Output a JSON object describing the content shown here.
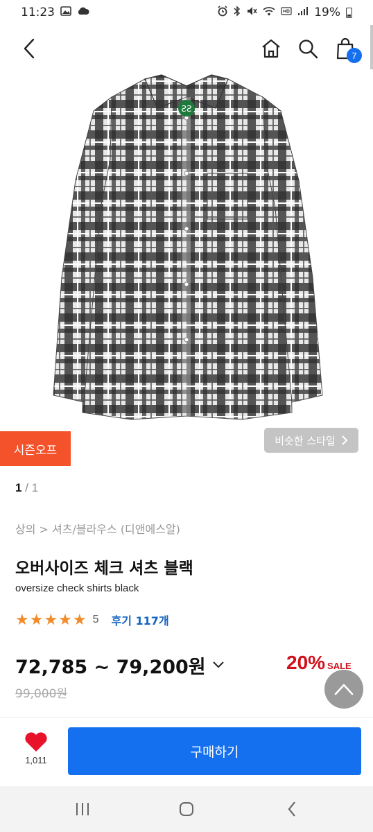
{
  "status_bar": {
    "time": "11:23",
    "battery": "19%"
  },
  "nav": {
    "cart_count": "7"
  },
  "product": {
    "season_badge": "시즌오프",
    "similar_style": "비슷한 스타일",
    "pager": {
      "current": "1",
      "separator": " / ",
      "total": "1"
    },
    "breadcrumb": "상의 > 셔츠/블라우스 (디앤에스알)",
    "title": "오버사이즈 체크 셔츠 블랙",
    "subtitle": "oversize check shirts black",
    "rating": {
      "stars": "★★★★★",
      "score": "5",
      "review_label": "후기 117개",
      "value": 5
    },
    "price": "72,785 ~ 79,200원",
    "discount_pct": "20%",
    "discount_sale": "SALE",
    "original_price": "99,000원"
  },
  "bottom": {
    "like_count": "1,011",
    "buy_label": "구매하기"
  },
  "colors": {
    "accent": "#1570ef",
    "badge": "#f4522b",
    "sale": "#d0111b",
    "star": "#f28b2a"
  }
}
